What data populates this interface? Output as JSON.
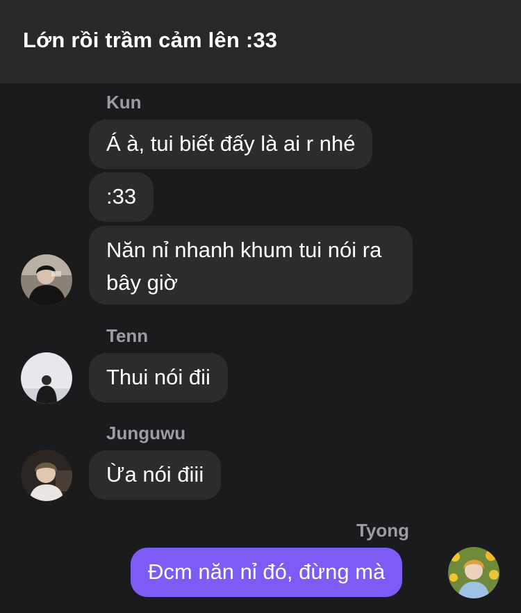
{
  "header": {
    "title": "Lớn rồi trầm cảm lên :33"
  },
  "groups": [
    {
      "sender": "Kun",
      "messages": [
        "Á à, tui biết đấy là ai r nhé",
        ":33",
        "Năn nỉ nhanh khum tui nói ra bây giờ"
      ]
    },
    {
      "sender": "Tenn",
      "messages": [
        "Thui nói đii"
      ]
    },
    {
      "sender": "Junguwu",
      "messages": [
        "Ừa nói điii"
      ]
    },
    {
      "sender": "Tyong",
      "messages": [
        "Đcm năn nỉ đó, đừng mà"
      ]
    }
  ],
  "avatars": {
    "kun": "avatar-photo-kun",
    "tenn": "avatar-photo-tenn",
    "junguwu": "avatar-photo-junguwu",
    "tyong": "avatar-photo-tyong"
  }
}
